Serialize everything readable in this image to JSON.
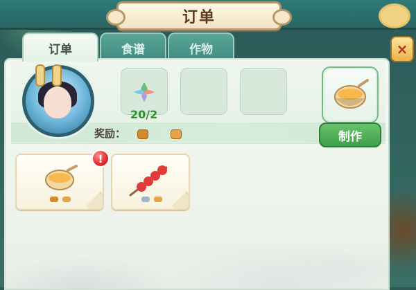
{
  "header": {
    "title": "订单"
  },
  "tabs": [
    {
      "label": "订单",
      "active": true
    },
    {
      "label": "食谱",
      "active": false
    },
    {
      "label": "作物",
      "active": false
    }
  ],
  "order": {
    "ingredient_count": "20/2",
    "reward_label": "奖励：",
    "make_button_label": "制作"
  },
  "alerts": {
    "order_alert": "!"
  },
  "close_icon": "×"
}
